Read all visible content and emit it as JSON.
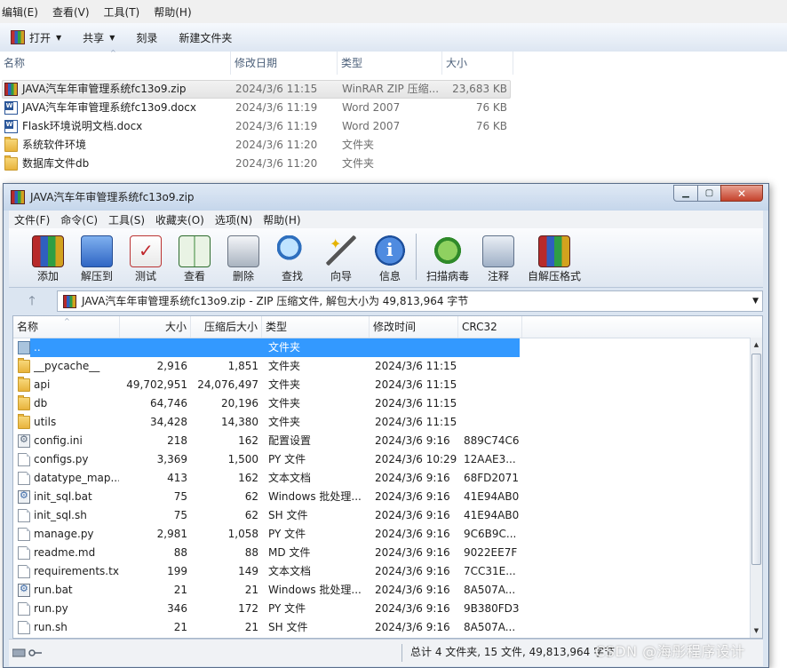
{
  "explorer": {
    "menu": [
      "编辑(E)",
      "查看(V)",
      "工具(T)",
      "帮助(H)"
    ],
    "toolbar": {
      "open": "打开",
      "share": "共享",
      "burn": "刻录",
      "new_folder": "新建文件夹"
    },
    "columns": {
      "name": "名称",
      "date": "修改日期",
      "type": "类型",
      "size": "大小"
    },
    "files": [
      {
        "name": "JAVA汽车年审管理系统fc13o9.zip",
        "date": "2024/3/6 11:15",
        "type": "WinRAR ZIP 压缩...",
        "size": "23,683 KB",
        "icon": "rar-icon"
      },
      {
        "name": "JAVA汽车年审管理系统fc13o9.docx",
        "date": "2024/3/6 11:19",
        "type": "Word 2007",
        "size": "76 KB",
        "icon": "word-icon"
      },
      {
        "name": "Flask环境说明文档.docx",
        "date": "2024/3/6 11:19",
        "type": "Word 2007",
        "size": "76 KB",
        "icon": "word-icon"
      },
      {
        "name": "系统软件环境",
        "date": "2024/3/6 11:20",
        "type": "文件夹",
        "size": "",
        "icon": "folder-icon"
      },
      {
        "name": "数据库文件db",
        "date": "2024/3/6 11:20",
        "type": "文件夹",
        "size": "",
        "icon": "folder-icon"
      }
    ]
  },
  "rar": {
    "title": "JAVA汽车年审管理系统fc13o9.zip",
    "close_glyph": "✕",
    "min_glyph": "▁",
    "max_glyph": "▢",
    "menu": [
      "文件(F)",
      "命令(C)",
      "工具(S)",
      "收藏夹(O)",
      "选项(N)",
      "帮助(H)"
    ],
    "tools": [
      {
        "label": "添加",
        "icon": "add-archive-icon"
      },
      {
        "label": "解压到",
        "icon": "extract-to-icon"
      },
      {
        "label": "测试",
        "icon": "test-icon"
      },
      {
        "label": "查看",
        "icon": "view-book-icon"
      },
      {
        "label": "删除",
        "icon": "trash-icon"
      },
      {
        "label": "查找",
        "icon": "magnifier-icon"
      },
      {
        "label": "向导",
        "icon": "wizard-wand-icon"
      },
      {
        "label": "信息",
        "icon": "info-icon"
      },
      {
        "label": "扫描病毒",
        "icon": "virus-scan-icon"
      },
      {
        "label": "注释",
        "icon": "comment-icon"
      },
      {
        "label": "自解压格式",
        "icon": "sfx-icon"
      }
    ],
    "up_glyph": "🡑",
    "address": "JAVA汽车年审管理系统fc13o9.zip - ZIP 压缩文件, 解包大小为 49,813,964 字节",
    "columns": {
      "name": "名称",
      "size": "大小",
      "packed": "压缩后大小",
      "type": "类型",
      "modified": "修改时间",
      "crc": "CRC32"
    },
    "rows": [
      {
        "name": "..",
        "size": "",
        "packed": "",
        "type": "文件夹",
        "modified": "",
        "crc": "",
        "icon": "parent-folder-icon",
        "selected": true
      },
      {
        "name": "__pycache__",
        "size": "2,916",
        "packed": "1,851",
        "type": "文件夹",
        "modified": "2024/3/6 11:15",
        "crc": "",
        "icon": "folder-icon"
      },
      {
        "name": "api",
        "size": "49,702,951",
        "packed": "24,076,497",
        "type": "文件夹",
        "modified": "2024/3/6 11:15",
        "crc": "",
        "icon": "folder-icon"
      },
      {
        "name": "db",
        "size": "64,746",
        "packed": "20,196",
        "type": "文件夹",
        "modified": "2024/3/6 11:15",
        "crc": "",
        "icon": "folder-icon"
      },
      {
        "name": "utils",
        "size": "34,428",
        "packed": "14,380",
        "type": "文件夹",
        "modified": "2024/3/6 11:15",
        "crc": "",
        "icon": "folder-icon"
      },
      {
        "name": "config.ini",
        "size": "218",
        "packed": "162",
        "type": "配置设置",
        "modified": "2024/3/6 9:16",
        "crc": "889C74C6",
        "icon": "settings-file-icon"
      },
      {
        "name": "configs.py",
        "size": "3,369",
        "packed": "1,500",
        "type": "PY 文件",
        "modified": "2024/3/6 10:29",
        "crc": "12AAE3...",
        "icon": "file-icon"
      },
      {
        "name": "datatype_map....",
        "size": "413",
        "packed": "162",
        "type": "文本文档",
        "modified": "2024/3/6 9:16",
        "crc": "68FD2071",
        "icon": "file-icon"
      },
      {
        "name": "init_sql.bat",
        "size": "75",
        "packed": "62",
        "type": "Windows 批处理...",
        "modified": "2024/3/6 9:16",
        "crc": "41E94AB0",
        "icon": "batch-file-icon"
      },
      {
        "name": "init_sql.sh",
        "size": "75",
        "packed": "62",
        "type": "SH 文件",
        "modified": "2024/3/6 9:16",
        "crc": "41E94AB0",
        "icon": "file-icon"
      },
      {
        "name": "manage.py",
        "size": "2,981",
        "packed": "1,058",
        "type": "PY 文件",
        "modified": "2024/3/6 9:16",
        "crc": "9C6B9C...",
        "icon": "file-icon"
      },
      {
        "name": "readme.md",
        "size": "88",
        "packed": "88",
        "type": "MD 文件",
        "modified": "2024/3/6 9:16",
        "crc": "9022EE7F",
        "icon": "file-icon"
      },
      {
        "name": "requirements.txt",
        "size": "199",
        "packed": "149",
        "type": "文本文档",
        "modified": "2024/3/6 9:16",
        "crc": "7CC31E...",
        "icon": "file-icon"
      },
      {
        "name": "run.bat",
        "size": "21",
        "packed": "21",
        "type": "Windows 批处理...",
        "modified": "2024/3/6 9:16",
        "crc": "8A507A...",
        "icon": "batch-file-icon"
      },
      {
        "name": "run.py",
        "size": "346",
        "packed": "172",
        "type": "PY 文件",
        "modified": "2024/3/6 9:16",
        "crc": "9B380FD3",
        "icon": "file-icon"
      },
      {
        "name": "run.sh",
        "size": "21",
        "packed": "21",
        "type": "SH 文件",
        "modified": "2024/3/6 9:16",
        "crc": "8A507A...",
        "icon": "file-icon"
      }
    ],
    "status": "总计 4 文件夹, 15 文件, 49,813,964 字节"
  },
  "watermark": "CSDN @海彤程序设计"
}
